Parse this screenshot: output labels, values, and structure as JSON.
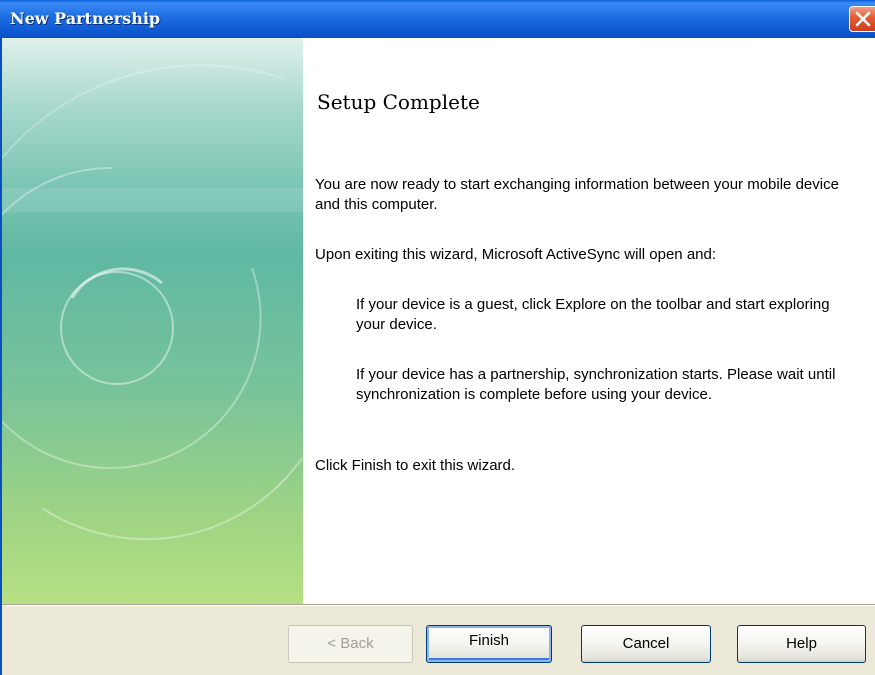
{
  "window": {
    "title": "New Partnership",
    "close_icon": "close-icon"
  },
  "content": {
    "heading": "Setup Complete",
    "para1": "You are now ready to start exchanging information between your mobile device and this computer.",
    "para2": "Upon exiting this wizard, Microsoft ActiveSync will open and:",
    "para3": "If your device is a guest, click Explore on the toolbar and start exploring your device.",
    "para4": "If your device has a partnership, synchronization starts. Please wait until synchronization is complete before using your device.",
    "para5": "Click Finish to exit this wizard."
  },
  "buttons": {
    "back": "< Back",
    "finish": "Finish",
    "cancel": "Cancel",
    "help": "Help"
  },
  "colors": {
    "titlebar": "#0d58d0",
    "close_button": "#e35b32",
    "side_panel_top": "#dff1ec",
    "side_panel_bottom": "#b6e083",
    "dialog_background": "#ece9d8"
  }
}
